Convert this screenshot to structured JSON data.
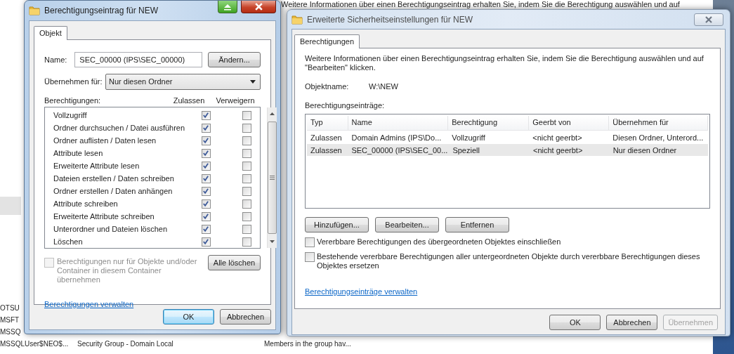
{
  "background": {
    "top_text": "Weitere Informationen über einen Berechtigungseintrag erhalten Sie, indem Sie die Berechtigung auswählen und auf",
    "rows": [
      {
        "name": "OTSU"
      },
      {
        "name": "MSFT"
      },
      {
        "name": "MSSQ"
      },
      {
        "name": "MSSQLUser$NEO$...",
        "type": "Security Group - Domain Local",
        "description": "Members in the group hav..."
      }
    ]
  },
  "entry_dialog": {
    "title": "Berechtigungseintrag für NEW",
    "tabs": [
      {
        "label": "Objekt",
        "selected": true
      }
    ],
    "name_label": "Name:",
    "name_value": "SEC_00000 (IPS\\SEC_00000)",
    "change_button": "Ändern...",
    "apply_label": "Übernehmen für:",
    "apply_value": "Nur diesen Ordner",
    "permissions_label": "Berechtigungen:",
    "allow_header": "Zulassen",
    "deny_header": "Verweigern",
    "permissions": [
      {
        "label": "Vollzugriff",
        "allow": true,
        "deny": false
      },
      {
        "label": "Ordner durchsuchen / Datei ausführen",
        "allow": true,
        "deny": false
      },
      {
        "label": "Ordner auflisten / Daten lesen",
        "allow": true,
        "deny": false
      },
      {
        "label": "Attribute lesen",
        "allow": true,
        "deny": false
      },
      {
        "label": "Erweiterte Attribute lesen",
        "allow": true,
        "deny": false
      },
      {
        "label": "Dateien erstellen / Daten schreiben",
        "allow": true,
        "deny": false
      },
      {
        "label": "Ordner erstellen / Daten anhängen",
        "allow": true,
        "deny": false
      },
      {
        "label": "Attribute schreiben",
        "allow": true,
        "deny": false
      },
      {
        "label": "Erweiterte Attribute schreiben",
        "allow": true,
        "deny": false
      },
      {
        "label": "Unterordner und Dateien löschen",
        "allow": true,
        "deny": false
      },
      {
        "label": "Löschen",
        "allow": true,
        "deny": false
      }
    ],
    "only_container": {
      "label": "Berechtigungen nur für Objekte und/oder Container in diesem Container übernehmen",
      "checked": false,
      "disabled": true
    },
    "clear_button": "Alle löschen",
    "link": "Berechtigungen verwalten",
    "buttons": [
      {
        "label": "OK",
        "default": true
      },
      {
        "label": "Abbrechen",
        "default": false
      }
    ]
  },
  "advanced_dialog": {
    "title": "Erweiterte Sicherheitseinstellungen für NEW",
    "tabs": [
      {
        "label": "Berechtigungen",
        "selected": true
      }
    ],
    "info": "Weitere Informationen über einen Berechtigungseintrag erhalten Sie, indem Sie die Berechtigung auswählen und auf \"Bearbeiten\" klicken.",
    "object_label": "Objektname:",
    "object_value": "W:\\NEW",
    "entries_label": "Berechtigungseinträge:",
    "columns": [
      "Typ",
      "Name",
      "Berechtigung",
      "Geerbt von",
      "Übernehmen für"
    ],
    "rows": [
      {
        "cells": [
          "Zulassen",
          "Domain Admins (IPS\\Do...",
          "Vollzugriff",
          "<nicht geerbt>",
          "Diesen Ordner, Unterord..."
        ],
        "selected": false
      },
      {
        "cells": [
          "Zulassen",
          "SEC_00000 (IPS\\SEC_00...",
          "Speziell",
          "<nicht geerbt>",
          "Nur diesen Ordner"
        ],
        "selected": true
      }
    ],
    "actions": [
      "Hinzufügen...",
      "Bearbeiten...",
      "Entfernen"
    ],
    "options": [
      {
        "label": "Vererbbare Berechtigungen des übergeordneten Objektes einschließen",
        "checked": false
      },
      {
        "label": "Bestehende vererbbare Berechtigungen aller untergeordneten Objekte durch vererbbare Berechtigungen dieses Objektes ersetzen",
        "checked": false
      }
    ],
    "link": "Berechtigungseinträge verwalten",
    "buttons": [
      {
        "label": "OK",
        "disabled": false
      },
      {
        "label": "Abbrechen",
        "disabled": false
      },
      {
        "label": "Übernehmen",
        "disabled": true
      }
    ]
  }
}
